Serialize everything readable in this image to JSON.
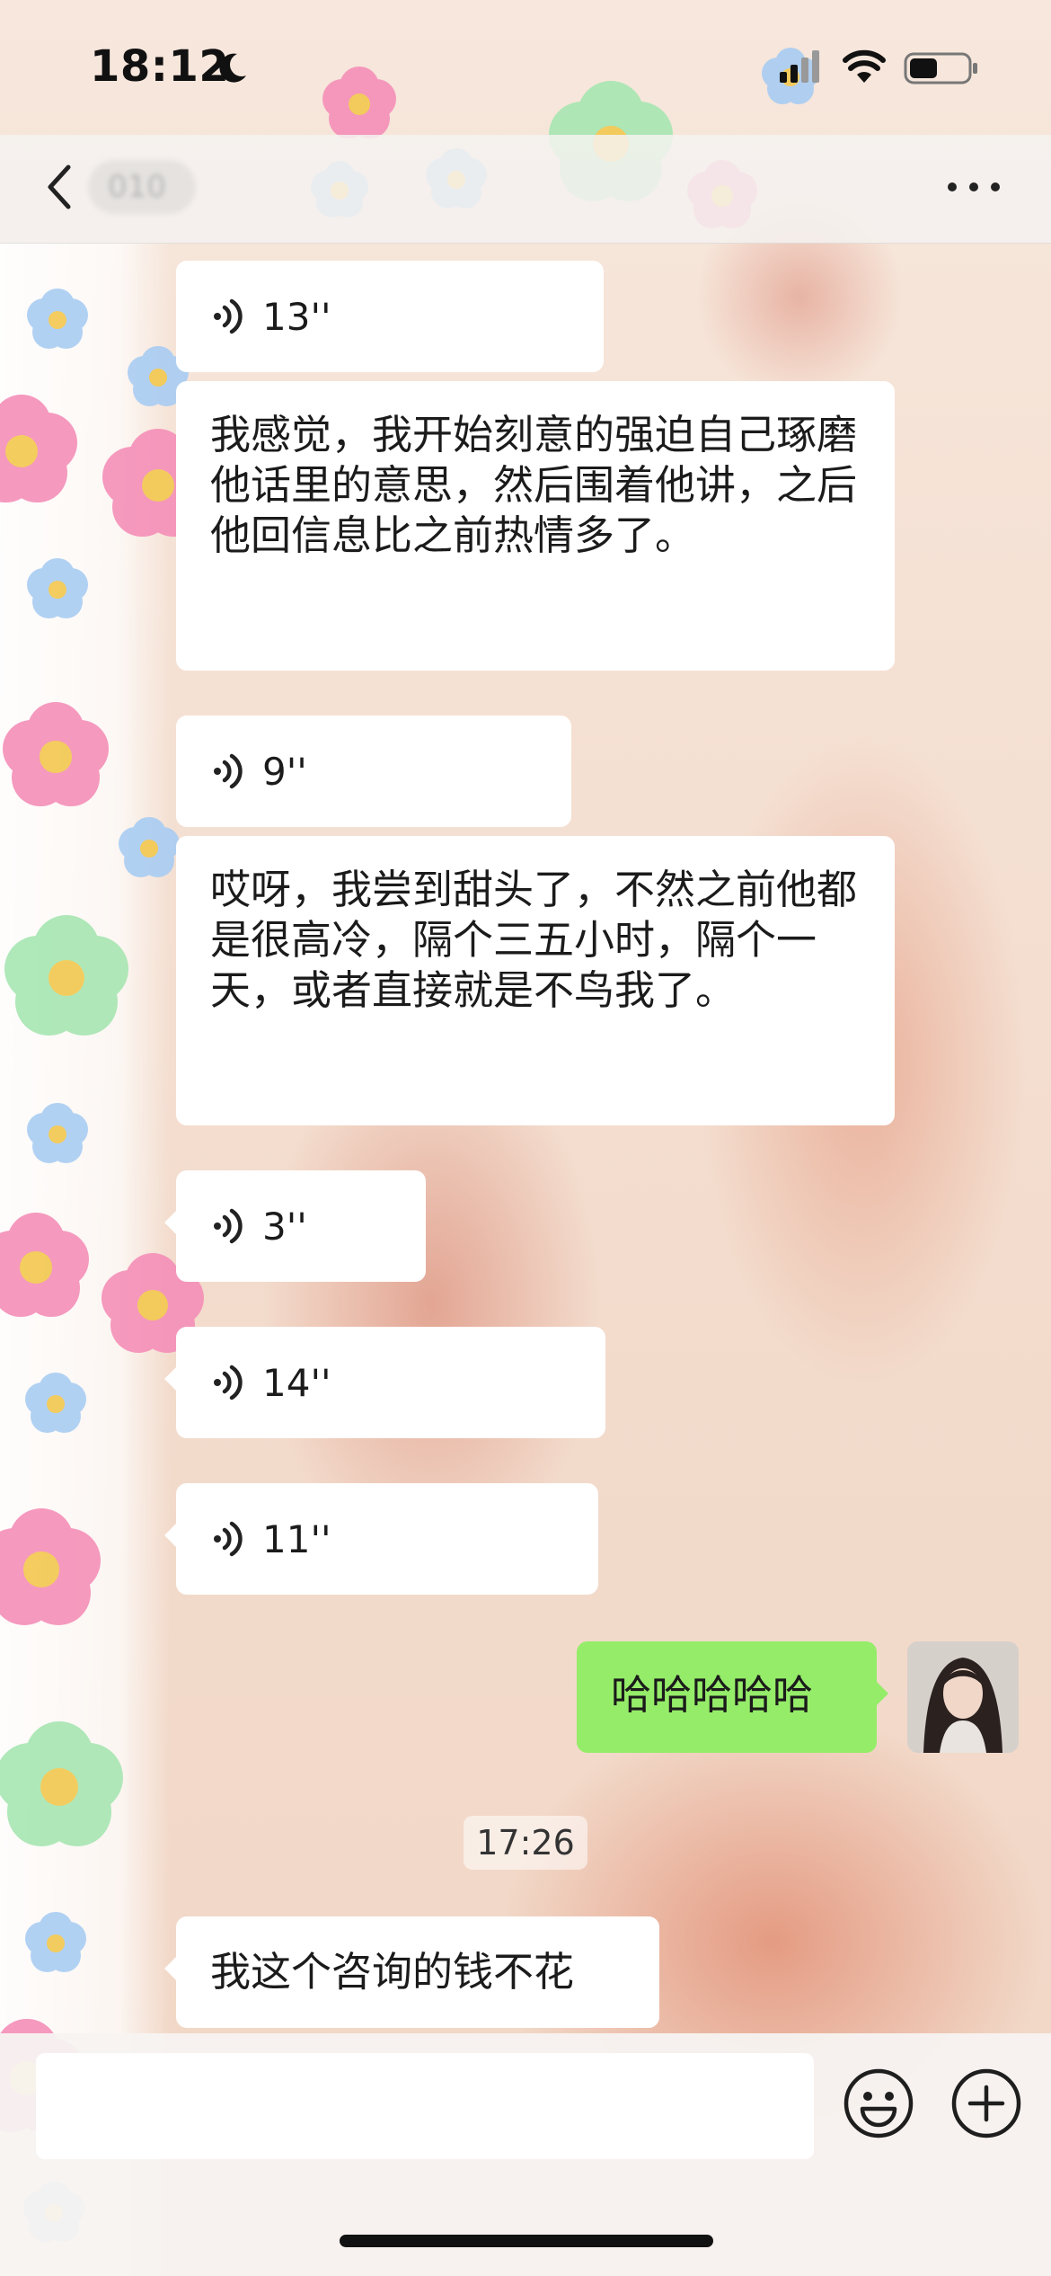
{
  "status_bar": {
    "time": "18:12",
    "icons": [
      "moon-icon",
      "signal-icon",
      "wifi-icon",
      "battery-icon"
    ]
  },
  "nav": {
    "back_icon": "chevron-left-icon",
    "contact_name": "010",
    "more_icon": "more-dots-icon"
  },
  "messages": [
    {
      "type": "voice",
      "side": "left",
      "duration": "13''"
    },
    {
      "type": "text",
      "side": "left",
      "text": "我感觉，我开始刻意的强迫自己琢磨他话里的意思，然后围着他讲，之后他回信息比之前热情多了。"
    },
    {
      "type": "voice",
      "side": "left",
      "duration": "9''"
    },
    {
      "type": "text",
      "side": "left",
      "text": "哎呀，我尝到甜头了，不然之前他都是很高冷，隔个三五小时，隔个一天，或者直接就是不鸟我了。"
    },
    {
      "type": "voice",
      "side": "left",
      "duration": "3''"
    },
    {
      "type": "voice",
      "side": "left",
      "duration": "14''"
    },
    {
      "type": "voice",
      "side": "left",
      "duration": "11''"
    },
    {
      "type": "text",
      "side": "right",
      "text": "哈哈哈哈哈"
    },
    {
      "type": "timestamp",
      "text": "17:26"
    },
    {
      "type": "text",
      "side": "left",
      "text": "我这个咨询的钱不花"
    }
  ],
  "input": {
    "value": "",
    "placeholder": "",
    "emoji_icon": "emoji-icon",
    "plus_icon": "plus-icon"
  },
  "colors": {
    "my_bubble": "#95ec69",
    "their_bubble": "#ffffff",
    "background": "#f3dccd"
  }
}
